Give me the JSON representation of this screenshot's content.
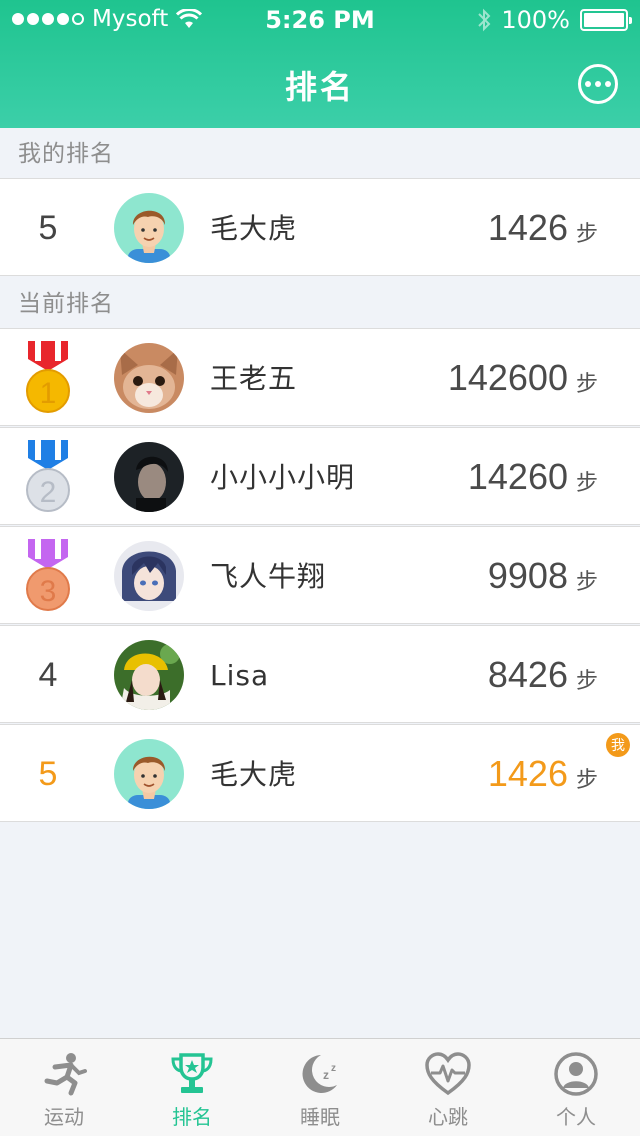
{
  "status_bar": {
    "carrier": "Mysoft",
    "time": "5:26 PM",
    "battery": "100%"
  },
  "nav": {
    "title": "排名",
    "more_icon": "more-horizontal-circle-icon"
  },
  "my_rank_section": {
    "title": "我的排名",
    "entry": {
      "rank": "5",
      "name": "毛大虎",
      "steps": "1426",
      "unit": "步",
      "avatar": "cartoon-boy-avatar"
    }
  },
  "current_rank_section": {
    "title": "当前排名",
    "entries": [
      {
        "rank": "1",
        "name": "王老五",
        "steps": "142600",
        "unit": "步",
        "medal": "gold-medal-icon",
        "avatar": "cat-avatar"
      },
      {
        "rank": "2",
        "name": "小小小小明",
        "steps": "14260",
        "unit": "步",
        "medal": "silver-medal-icon",
        "avatar": "man-photo-avatar"
      },
      {
        "rank": "3",
        "name": "飞人牛翔",
        "steps": "9908",
        "unit": "步",
        "medal": "bronze-medal-icon",
        "avatar": "anime-avatar"
      },
      {
        "rank": "4",
        "name": "Lisa",
        "steps": "8426",
        "unit": "步",
        "avatar": "girl-photo-avatar"
      },
      {
        "rank": "5",
        "name": "毛大虎",
        "steps": "1426",
        "unit": "步",
        "avatar": "cartoon-boy-avatar",
        "badge": "我"
      }
    ]
  },
  "colors": {
    "primary": "#24c493",
    "highlight": "#f39a1a",
    "gold": "#f5b800",
    "silver": "#c9ced6",
    "bronze": "#f09a6e"
  },
  "tabbar": {
    "tabs": [
      {
        "label": "运动",
        "icon": "running-icon",
        "active": false
      },
      {
        "label": "排名",
        "icon": "trophy-icon",
        "active": true
      },
      {
        "label": "睡眠",
        "icon": "moon-zzz-icon",
        "active": false
      },
      {
        "label": "心跳",
        "icon": "heartbeat-icon",
        "active": false
      },
      {
        "label": "个人",
        "icon": "user-circle-icon",
        "active": false
      }
    ]
  }
}
